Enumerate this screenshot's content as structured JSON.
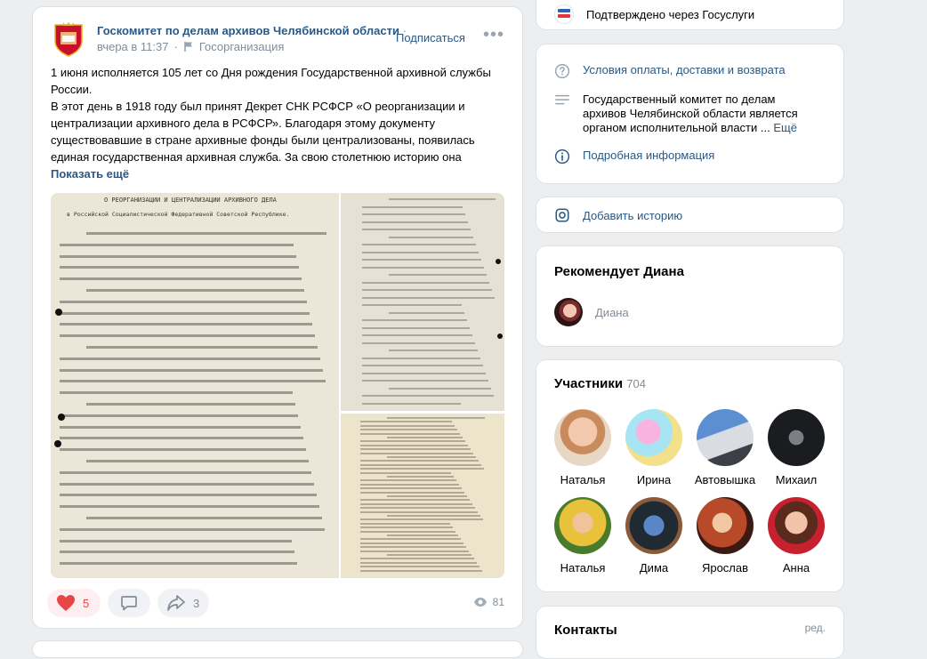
{
  "post": {
    "group_name": "Госкомитет по делам архивов Челябинской области",
    "time": "вчера в 11:37",
    "category": "Госорганизация",
    "subscribe_label": "Подписаться",
    "text_lines": [
      "1 июня исполняется 105 лет со Дня рождения Государственной архивной службы России.",
      "В этот день в 1918 году был принят Декрет СНК РСФСР «О реорганизации и централизации архивного дела в РСФСР». Благодаря этому документу существовавшие в стране архивные фонды были централизованы, появилась единая государственная архивная служба. За свою столетнюю историю она"
    ],
    "show_more": "Показать ещё",
    "document_heading": "О РЕОРГАНИЗАЦИИ И ЦЕНТРАЛИЗАЦИИ АРХИВНОГО ДЕЛА",
    "document_subheading": "в Российской Социалистической Федеративной Советской Республике.",
    "likes": "5",
    "shares": "3",
    "views": "81"
  },
  "gosuslugi": {
    "label": "Подтверждено через Госуслуги",
    "logo_text": "гос услуги"
  },
  "info": {
    "terms_link": "Условия оплаты, доставки и возврата",
    "description": "Государственный комитет по делам архивов Челябинской области является органом исполнительной власти ...",
    "more": "Ещё",
    "details_link": "Подробная информация"
  },
  "story": {
    "label": "Добавить историю"
  },
  "recommend": {
    "title": "Рекомендует Диана",
    "name": "Диана"
  },
  "members": {
    "title": "Участники",
    "count": "704",
    "list": [
      {
        "name": "Наталья"
      },
      {
        "name": "Ирина"
      },
      {
        "name": "Автовышка"
      },
      {
        "name": "Михаил"
      },
      {
        "name": "Наталья"
      },
      {
        "name": "Дима"
      },
      {
        "name": "Ярослав"
      },
      {
        "name": "Анна"
      }
    ]
  },
  "contacts": {
    "title": "Контакты",
    "edit": "ред."
  },
  "colors": {
    "link": "#2a5885",
    "accent": "#e64646",
    "muted": "#818c99"
  }
}
